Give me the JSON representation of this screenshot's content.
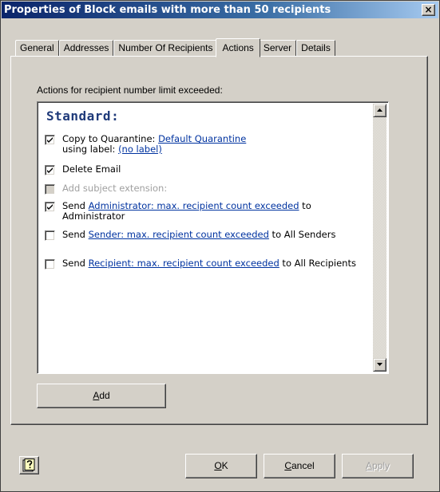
{
  "window": {
    "title": "Properties of Block emails with more than 50 recipients",
    "close_label": "×"
  },
  "tabs": [
    {
      "label": "General",
      "active": false
    },
    {
      "label": "Addresses",
      "active": false
    },
    {
      "label": "Number Of Recipients",
      "active": false
    },
    {
      "label": "Actions",
      "active": true
    },
    {
      "label": "Server",
      "active": false
    },
    {
      "label": "Details",
      "active": false
    }
  ],
  "actions": {
    "section_label": "Actions for recipient number limit exceeded:",
    "heading": "Standard:",
    "items": [
      {
        "checked": true,
        "disabled": false,
        "prefix": "Copy to Quarantine: ",
        "link": "Default Quarantine",
        "line2_prefix": "using label: ",
        "line2_link": "(no label)"
      },
      {
        "checked": true,
        "disabled": false,
        "text": "Delete Email"
      },
      {
        "checked": false,
        "disabled": true,
        "text": "Add subject extension:"
      },
      {
        "checked": true,
        "disabled": false,
        "prefix": "Send ",
        "link": "Administrator: max. recipient count exceeded",
        "suffix": " to Administrator"
      },
      {
        "checked": false,
        "disabled": false,
        "prefix": "Send ",
        "link": "Sender: max. recipient count exceeded",
        "suffix": " to All Senders"
      },
      {
        "checked": false,
        "disabled": false,
        "prefix": "Send ",
        "link": "Recipient: max. recipient count exceeded",
        "suffix": " to All Recipients"
      }
    ],
    "add_button": {
      "pre": "",
      "accel": "A",
      "post": "dd"
    }
  },
  "footer": {
    "ok": {
      "pre": "",
      "accel": "O",
      "post": "K"
    },
    "cancel": {
      "pre": "",
      "accel": "C",
      "post": "ancel"
    },
    "apply": {
      "pre": "",
      "accel": "A",
      "post": "pply"
    }
  },
  "icons": {
    "help": "context-help-icon",
    "checkmark": "checkmark-icon",
    "scroll_up": "scroll-up-arrow-icon",
    "scroll_down": "scroll-down-arrow-icon"
  },
  "colors": {
    "title_bar": "#0a246a",
    "link": "#0033a0",
    "heading": "#1f3a7a",
    "face": "#d4d0c8"
  }
}
